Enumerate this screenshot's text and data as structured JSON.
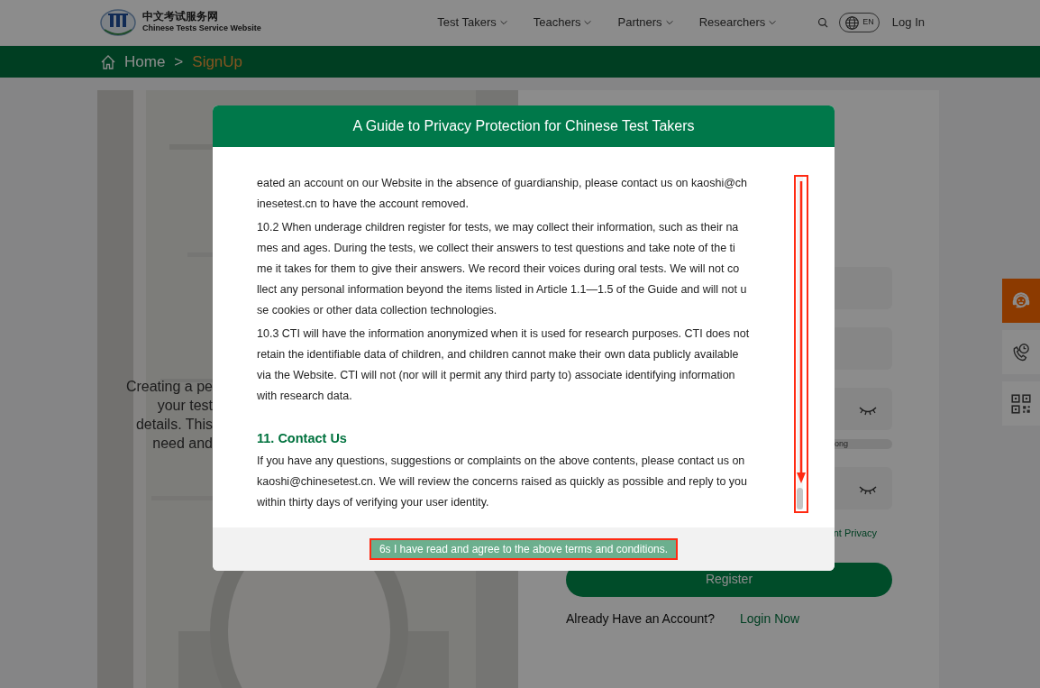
{
  "header": {
    "site_name_cn": "中文考试服务网",
    "site_name_en": "Chinese Tests Service Website",
    "nav": [
      {
        "label": "Test Takers"
      },
      {
        "label": "Teachers"
      },
      {
        "label": "Partners"
      },
      {
        "label": "Researchers"
      }
    ],
    "language": "EN",
    "login": "Log In"
  },
  "breadcrumb": {
    "home": "Home",
    "separator": ">",
    "current": "SignUp"
  },
  "intro_lines": [
    "Creating a pe",
    "your test",
    "details. This",
    "need and"
  ],
  "form": {
    "fields": [
      {
        "kind": "text"
      },
      {
        "kind": "text"
      },
      {
        "kind": "password"
      },
      {
        "kind": "strength",
        "label": "ong"
      },
      {
        "kind": "password"
      }
    ],
    "privacy_link": "nt Privacy",
    "register_button": "Register",
    "login_prompt": "Already Have an Account?",
    "login_link": "Login Now"
  },
  "side_tools": [
    {
      "kind": "support",
      "active": true
    },
    {
      "kind": "phone",
      "active": false
    },
    {
      "kind": "qr",
      "active": false
    }
  ],
  "modal": {
    "title": "A Guide to Privacy Protection for Chinese Test Takers",
    "sections": [
      {
        "kind": "paragraph",
        "lines": [
          "eated an account on our Website in the absence of guardianship, please contact us on kaoshi@ch",
          "inesetest.cn to have the account removed."
        ]
      },
      {
        "kind": "paragraph",
        "lines": [
          "10.2 When underage children register for tests, we may collect their information, such as their na",
          "mes and ages. During the tests, we collect their answers to test questions and take note of the ti",
          "me it takes for them to give their answers. We record their voices during oral tests. We will not co",
          "llect any personal information beyond the items listed in Article 1.1—1.5 of the Guide and will not u",
          "se cookies or other data collection technologies."
        ]
      },
      {
        "kind": "paragraph",
        "lines": [
          "10.3 CTI will have the information anonymized when it is used for research purposes. CTI does not",
          "retain the identifiable data of children, and children cannot make their own data publicly available",
          "via the Website. CTI will not (nor will it permit any third party to) associate identifying information",
          "with research data."
        ]
      },
      {
        "kind": "heading",
        "text": "11. Contact Us"
      },
      {
        "kind": "paragraph",
        "lines": [
          "If you have any questions, suggestions or complaints on the above contents, please contact us on",
          "kaoshi@chinesetest.cn. We will review the concerns raised as quickly as possible and reply to you",
          "within thirty days of verifying your user identity."
        ]
      }
    ],
    "agree_button": {
      "label": "6s I have read and agree to the above terms and conditions.",
      "disabled": true
    }
  }
}
